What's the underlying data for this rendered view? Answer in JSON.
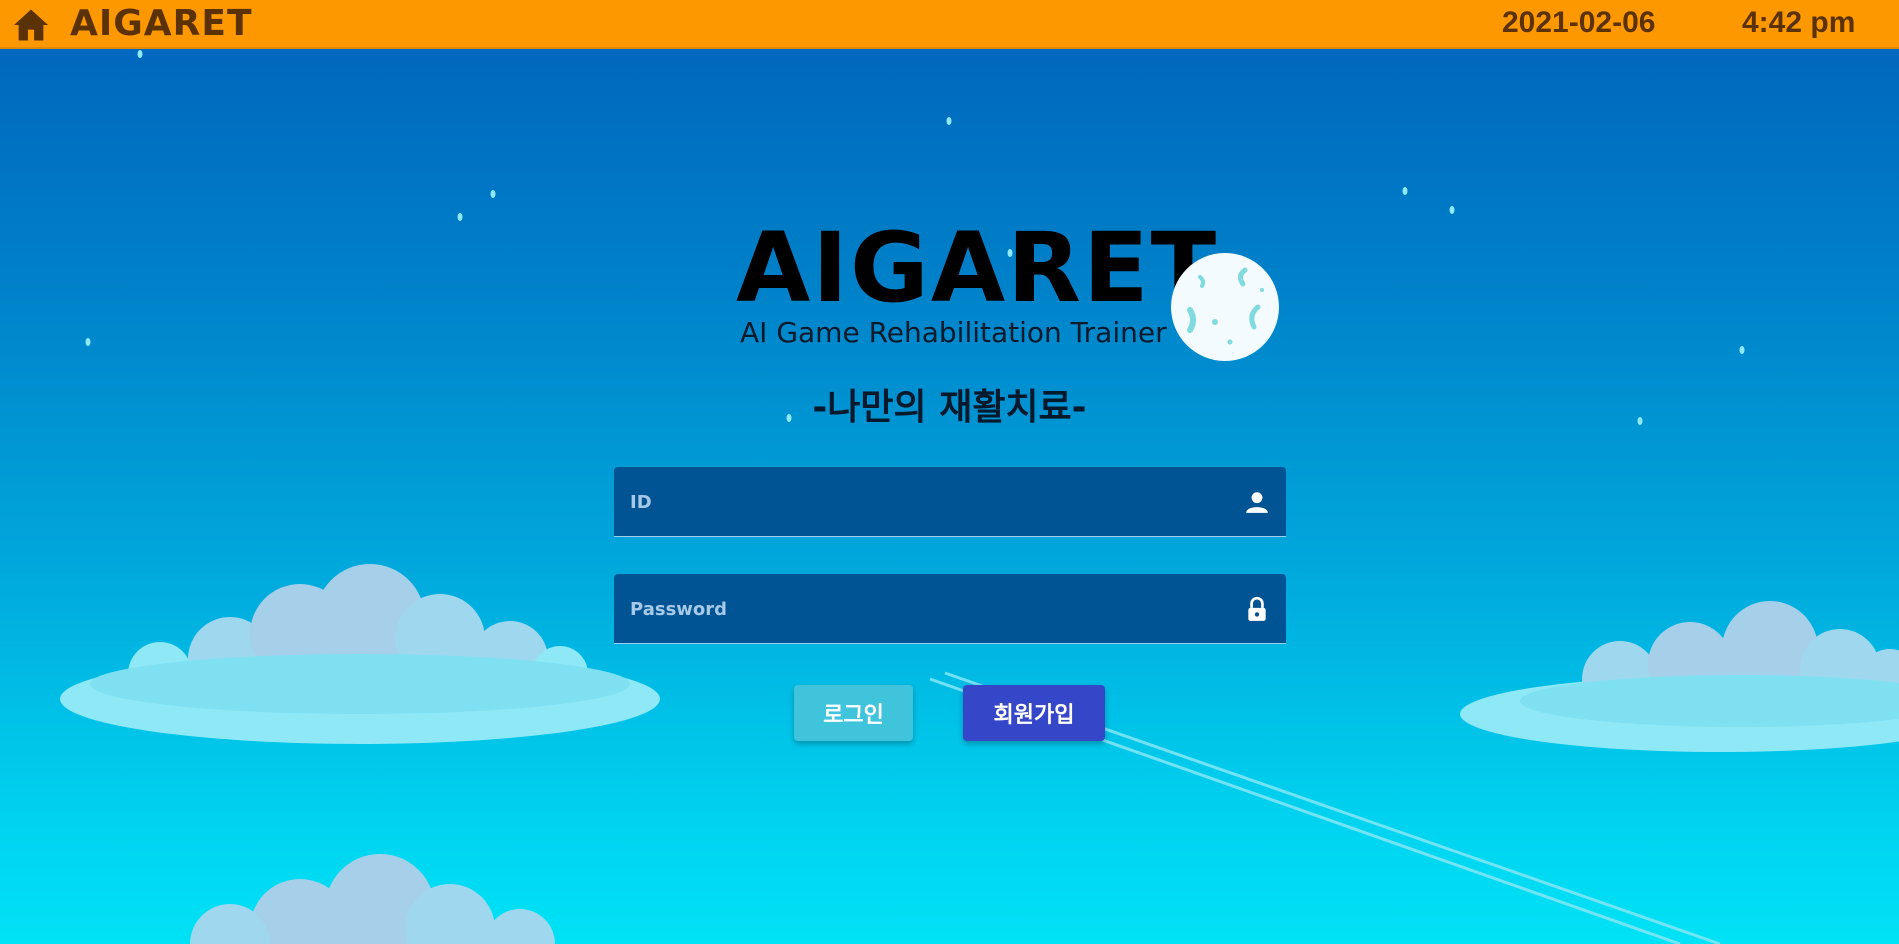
{
  "header": {
    "app_name": "AIGARET",
    "date": "2021-02-06",
    "time": "4:42 pm",
    "home_icon": "home-icon",
    "background_color": "#fe9800"
  },
  "logo": {
    "title": "AIGARET",
    "subtitle": "AI Game Rehabilitation Trainer",
    "moon_icon": "moon-icon"
  },
  "tagline": "-나만의 재활치료-",
  "form": {
    "id_placeholder": "ID",
    "id_icon": "user-icon",
    "password_placeholder": "Password",
    "password_icon": "lock-icon"
  },
  "buttons": {
    "login_label": "로그인",
    "signup_label": "회원가입",
    "login_color": "#40c4dc",
    "signup_color": "#3547c8"
  }
}
